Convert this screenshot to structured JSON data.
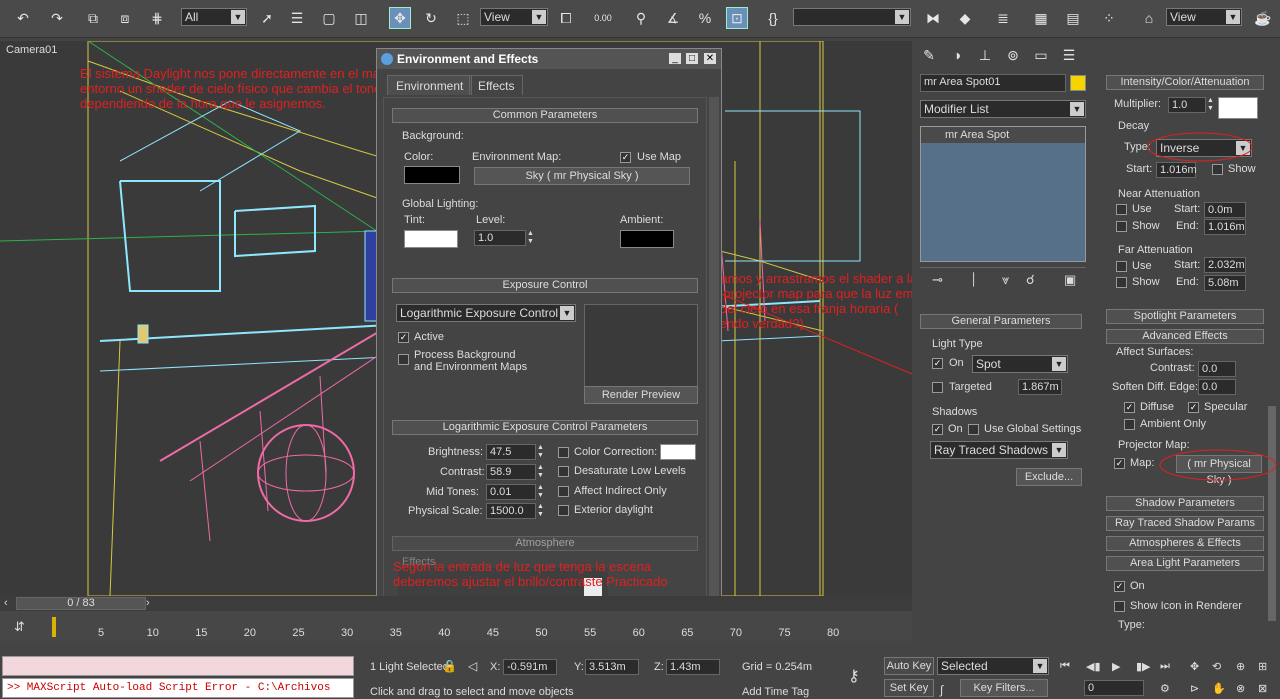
{
  "toolbar": {
    "selection_filter": "All",
    "ref_coord_system": "View",
    "percent_snap": "0.00",
    "named_selection": "",
    "view_dropdown": "View"
  },
  "viewport": {
    "label": "Camera01",
    "notes": {
      "daylight": "El sistema Daylight nos pone directamente en el mapa de entorno un shader de cielo físico que cambia el tono dependiendo de la hora que le asignemos.",
      "drag": "Pinchamos y arrastramos el shader a la luz como projector map para que la luz emita el color del cielo en esa franja horaria ( estupendo verdad?)",
      "brightness": "Según la entrada de luz que tenga la escena deberemos ajustar el brillo/contraste Practicado"
    }
  },
  "dialog": {
    "title": "Environment and Effects",
    "tabs": [
      "Environment",
      "Effects"
    ],
    "common_parameters": "Common Parameters",
    "background_label": "Background:",
    "color_label": "Color:",
    "env_map_label": "Environment Map:",
    "use_map": "Use Map",
    "env_map_button": "Sky  ( mr Physical Sky )",
    "global_lighting": "Global Lighting:",
    "tint": "Tint:",
    "level": "Level:",
    "level_value": "1.0",
    "ambient": "Ambient:",
    "exposure_control": "Exposure Control",
    "exposure_type": "Logarithmic Exposure Control",
    "active": "Active",
    "process_bg": "Process Background and Environment Maps",
    "render_preview": "Render Preview",
    "log_params": "Logarithmic Exposure Control Parameters",
    "brightness_label": "Brightness:",
    "brightness": "47.5",
    "contrast_label": "Contrast:",
    "contrast": "58.9",
    "midtones_label": "Mid Tones:",
    "midtones": "0.01",
    "physscale_label": "Physical Scale:",
    "physscale": "1500.0",
    "color_correction": "Color Correction:",
    "desaturate": "Desaturate Low Levels",
    "affect_indirect": "Affect Indirect Only",
    "exterior_daylight": "Exterior daylight",
    "atmosphere": "Atmosphere",
    "effects_lbl": "Effects"
  },
  "command_panel": {
    "object_name": "mr Area Spot01",
    "object_color": "#f5d400",
    "modifier_list": "Modifier List",
    "stack_item": "mr Area Spot",
    "general_parameters": "General Parameters",
    "light_type": "Light Type",
    "on": "On",
    "light_kind": "Spot",
    "targeted": "Targeted",
    "targeted_value": "1.867m",
    "shadows": "Shadows",
    "use_global": "Use Global Settings",
    "shadow_type": "Ray Traced Shadows",
    "exclude": "Exclude...",
    "intensity": "Intensity/Color/Attenuation",
    "multiplier_label": "Multiplier:",
    "multiplier": "1.0",
    "decay": "Decay",
    "type_label": "Type:",
    "decay_type": "Inverse",
    "start_label": "Start:",
    "decay_start": "1.016m",
    "show": "Show",
    "near_atten": "Near Attenuation",
    "use": "Use",
    "near_start": "0.0m",
    "end_label": "End:",
    "near_end": "1.016m",
    "far_atten": "Far Attenuation",
    "far_start": "2.032m",
    "far_end": "5.08m",
    "spotlight_params": "Spotlight Parameters",
    "advanced_effects": "Advanced Effects",
    "affect_surfaces": "Affect Surfaces:",
    "contrast_label": "Contrast:",
    "contrast": "0.0",
    "soften_label": "Soften Diff. Edge:",
    "soften": "0.0",
    "diffuse": "Diffuse",
    "specular": "Specular",
    "ambient_only": "Ambient Only",
    "projector_map": "Projector Map:",
    "map_label": "Map:",
    "map_button": "( mr Physical Sky )",
    "shadow_params": "Shadow Parameters",
    "ray_traced_params": "Ray Traced Shadow Params",
    "atmos_effects": "Atmospheres & Effects",
    "area_light_params": "Area Light Parameters",
    "show_icon": "Show Icon in Renderer",
    "type2": "Type:"
  },
  "timeline": {
    "frame": "0 / 83",
    "ticks": [
      "5",
      "10",
      "15",
      "20",
      "25",
      "30",
      "35",
      "40",
      "45",
      "50",
      "55",
      "60",
      "65",
      "70",
      "75",
      "80"
    ]
  },
  "status": {
    "maxscript": ">> MAXScript Auto-load Script Error - C:\\Archivos",
    "selection": "1 Light Selected",
    "prompt": "Click and drag to select and move objects",
    "x_label": "X:",
    "x": "-0.591m",
    "y_label": "Y:",
    "y": "3.513m",
    "z_label": "Z:",
    "z": "1.43m",
    "grid": "Grid = 0.254m",
    "add_time_tag": "Add Time Tag",
    "auto_key": "Auto Key",
    "set_key": "Set Key",
    "selected": "Selected",
    "key_filters": "Key Filters...",
    "current_frame": "0"
  }
}
